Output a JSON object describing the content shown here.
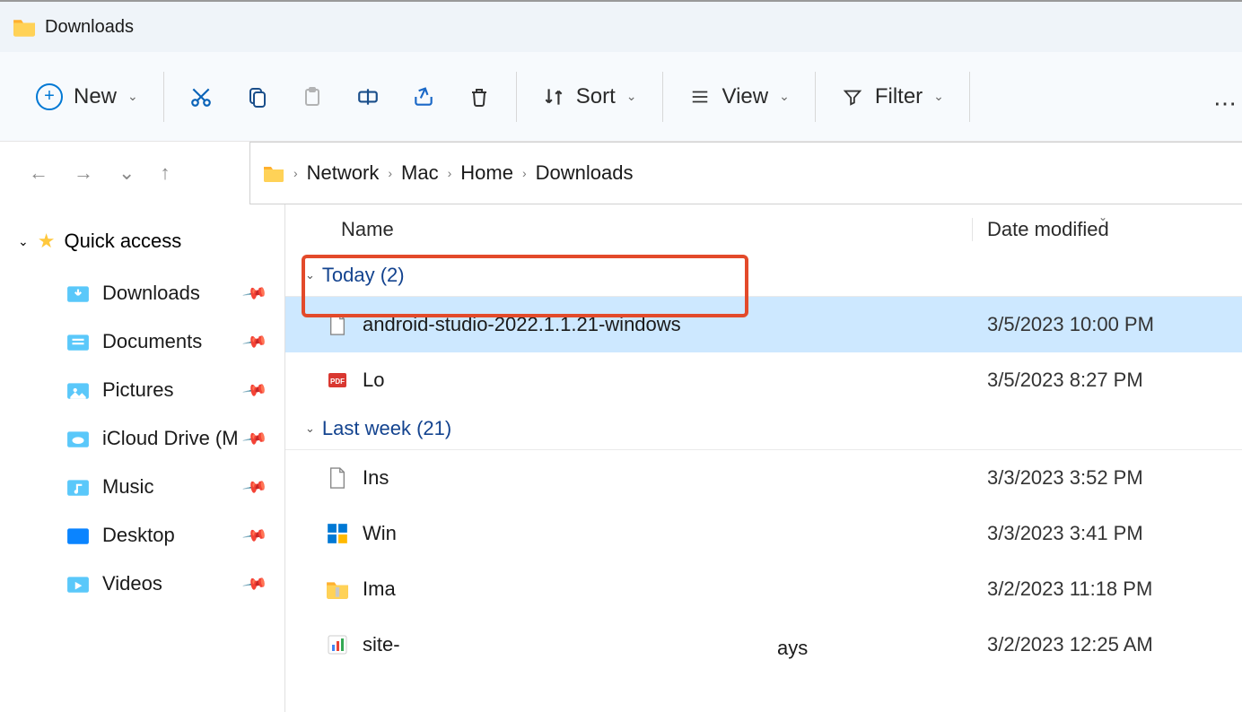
{
  "window": {
    "title": "Downloads"
  },
  "toolbar": {
    "new": "New",
    "sort": "Sort",
    "view": "View",
    "filter": "Filter"
  },
  "breadcrumb": [
    "Network",
    "Mac",
    "Home",
    "Downloads"
  ],
  "sidebar": {
    "heading": "Quick access",
    "items": [
      {
        "label": "Downloads",
        "icon": "downloads"
      },
      {
        "label": "Documents",
        "icon": "documents"
      },
      {
        "label": "Pictures",
        "icon": "pictures"
      },
      {
        "label": "iCloud Drive (M",
        "icon": "icloud"
      },
      {
        "label": "Music",
        "icon": "music"
      },
      {
        "label": "Desktop",
        "icon": "desktop"
      },
      {
        "label": "Videos",
        "icon": "videos"
      }
    ]
  },
  "columns": {
    "name": "Name",
    "date": "Date modified"
  },
  "groups": [
    {
      "label": "Today (2)",
      "files": [
        {
          "name": "android-studio-2022.1.1.21-windows",
          "date": "3/5/2023 10:00 PM",
          "icon": "file",
          "selected": true,
          "highlighted": true
        },
        {
          "name": "Lo",
          "date": "3/5/2023 8:27 PM",
          "icon": "pdf"
        }
      ]
    },
    {
      "label": "Last week (21)",
      "files": [
        {
          "name": "Ins",
          "date": "3/3/2023 3:52 PM",
          "icon": "file"
        },
        {
          "name": "Win",
          "date": "3/3/2023 3:41 PM",
          "icon": "winlogo"
        },
        {
          "name": "Ima",
          "date": "3/2/2023 11:18 PM",
          "icon": "zipfolder"
        },
        {
          "name": "site-",
          "date": "3/2/2023 12:25 AM",
          "icon": "chart"
        }
      ]
    }
  ],
  "orphan_text": "ays"
}
